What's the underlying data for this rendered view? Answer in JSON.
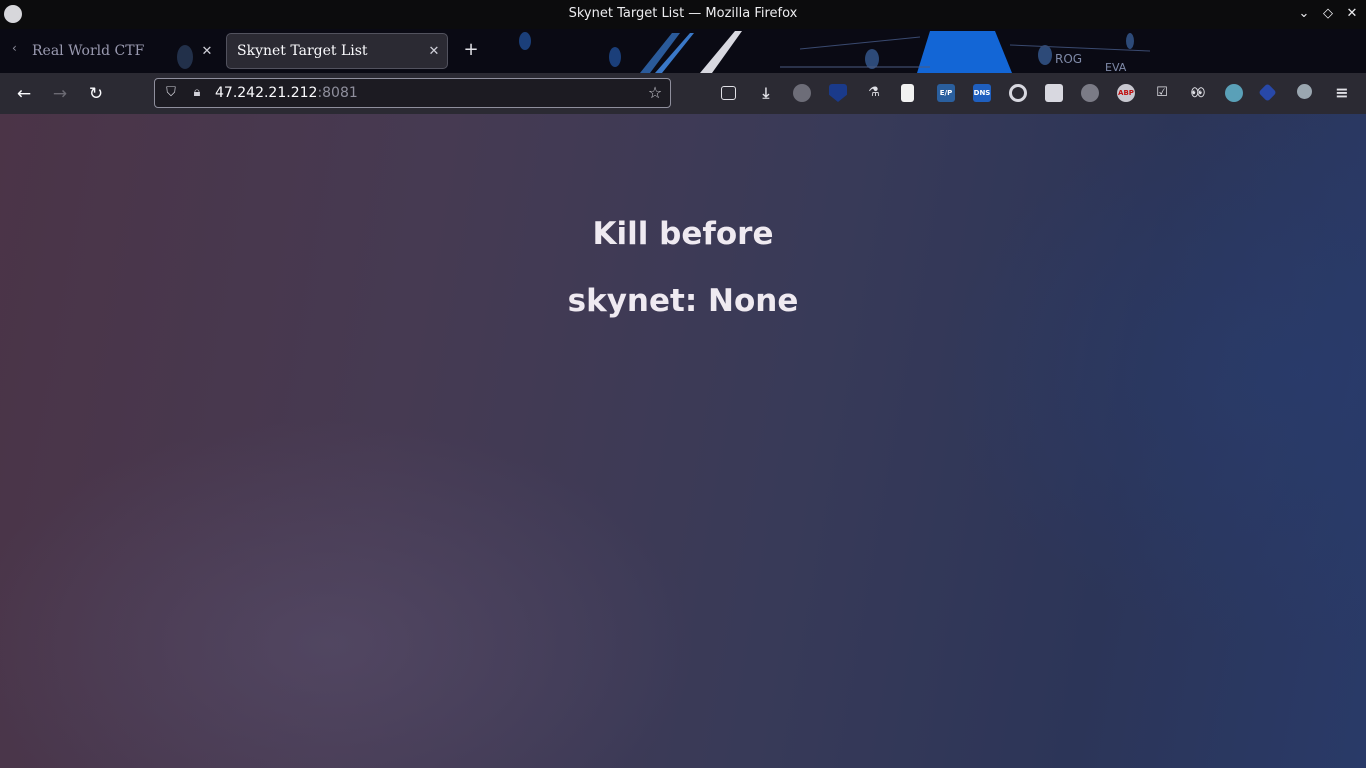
{
  "window": {
    "title": "Skynet Target List — Mozilla Firefox",
    "controls": [
      "chevron-down-icon",
      "diamond-icon",
      "close-icon"
    ]
  },
  "tabs": [
    {
      "label": "Real World CTF",
      "active": false
    },
    {
      "label": "Skynet Target List",
      "active": true
    }
  ],
  "navbar": {
    "url_host": "47.242.21.212",
    "url_port": ":8081"
  },
  "extensions": [
    {
      "name": "pocket-icon"
    },
    {
      "name": "downloads-icon"
    },
    {
      "name": "extension-1-icon"
    },
    {
      "name": "bitwarden-icon"
    },
    {
      "name": "extension-3-icon"
    },
    {
      "name": "notes-icon"
    },
    {
      "name": "ezp-extension-icon",
      "text": "E/P"
    },
    {
      "name": "dns-extension-icon",
      "text": "DNS"
    },
    {
      "name": "record-extension-icon"
    },
    {
      "name": "extension-save-icon"
    },
    {
      "name": "extension-badge-icon"
    },
    {
      "name": "adblock-plus-icon",
      "text": "ABP"
    },
    {
      "name": "extension-check-icon"
    },
    {
      "name": "extension-eyes-icon"
    },
    {
      "name": "extension-c-icon"
    },
    {
      "name": "extension-diamond-icon"
    },
    {
      "name": "extension-circle-icon"
    },
    {
      "name": "menu-icon"
    }
  ],
  "page": {
    "line1": "Kill before",
    "line2": "skynet: None"
  },
  "colors": {
    "accent": "#0060df",
    "chrome": "#2b2a33",
    "url_port": "#8f8f9d"
  }
}
